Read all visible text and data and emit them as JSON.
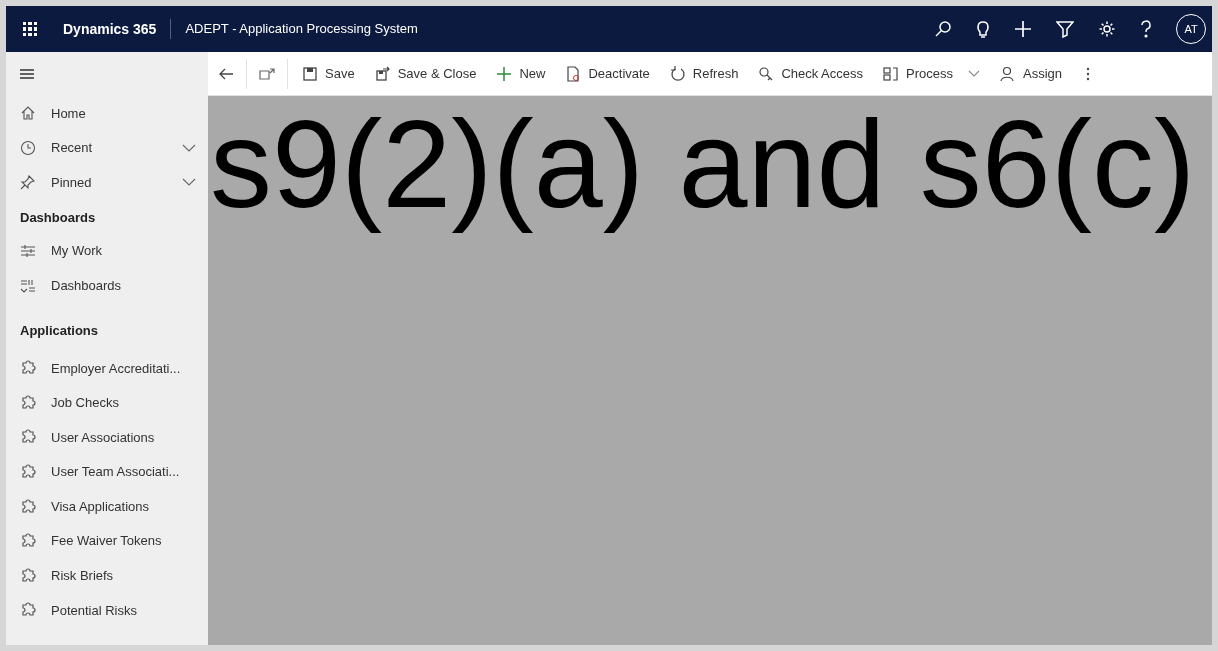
{
  "header": {
    "app_name": "Dynamics 365",
    "title": "ADEPT - Application Processing System",
    "avatar": "AT"
  },
  "toolbar": [
    {
      "kind": "button",
      "label": "Save"
    },
    {
      "kind": "button",
      "label": "Save & Close"
    },
    {
      "kind": "button",
      "label": "New"
    },
    {
      "kind": "button",
      "label": "Deactivate"
    },
    {
      "kind": "button",
      "label": "Refresh"
    },
    {
      "kind": "button",
      "label": "Check Access"
    },
    {
      "kind": "dropdown",
      "label": "Process"
    },
    {
      "kind": "button",
      "label": "Assign"
    }
  ],
  "sidebar": {
    "items": [
      {
        "kind": "link",
        "label": "Home"
      },
      {
        "kind": "link",
        "label": "Recent",
        "expanded": false
      },
      {
        "kind": "link",
        "label": "Pinned",
        "expanded": false
      },
      {
        "kind": "heading",
        "label": "Dashboards"
      },
      {
        "kind": "link",
        "label": "My Work"
      },
      {
        "kind": "link",
        "label": "Dashboards"
      },
      {
        "kind": "heading",
        "label": "Applications"
      },
      {
        "kind": "link",
        "label": "Employer Accreditati..."
      },
      {
        "kind": "link",
        "label": "Job Checks"
      },
      {
        "kind": "link",
        "label": "User Associations"
      },
      {
        "kind": "link",
        "label": "User Team Associati..."
      },
      {
        "kind": "link",
        "label": "Visa Applications"
      },
      {
        "kind": "link",
        "label": "Fee Waiver Tokens"
      },
      {
        "kind": "link",
        "label": "Risk Briefs"
      },
      {
        "kind": "link",
        "label": "Potential Risks"
      }
    ]
  },
  "redaction": {
    "label": "s9(2)(a) and s6(c)"
  }
}
